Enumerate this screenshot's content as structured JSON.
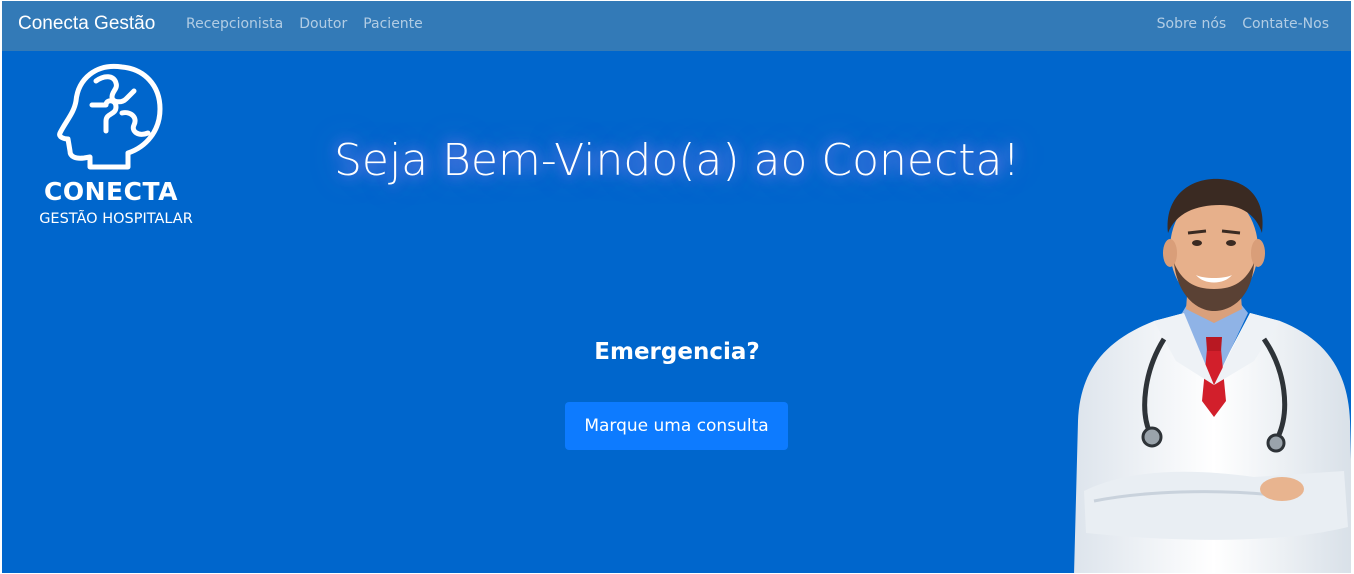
{
  "navbar": {
    "brand": "Conecta Gestão",
    "left_links": [
      "Recepcionista",
      "Doutor",
      "Paciente"
    ],
    "right_links": [
      "Sobre nós",
      "Contate-Nos"
    ]
  },
  "logo": {
    "icon": "head-puzzle-icon",
    "word": "CONECTA",
    "subtitle": "GESTÃO HOSPITALAR"
  },
  "hero": {
    "headline": "Seja Bem-Vindo(a) ao Conecta!",
    "emergency_text": "Emergencia?",
    "cta_label": "Marque uma consulta",
    "image": "doctor-illustration"
  },
  "colors": {
    "navbar": "#337ab7",
    "background": "#0066cc",
    "button": "#0d7bff",
    "text": "#ffffff"
  }
}
